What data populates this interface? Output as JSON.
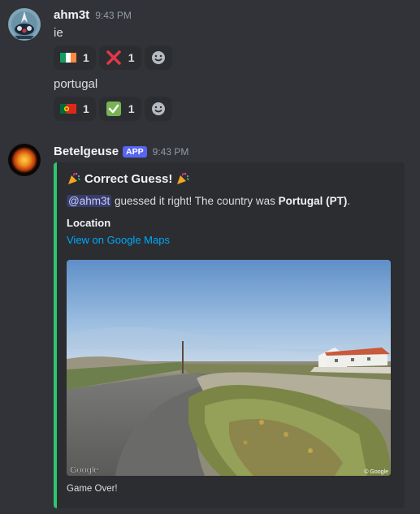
{
  "messages": [
    {
      "username": "ahm3t",
      "time": "9:43 PM",
      "lines": [
        {
          "text": "ie",
          "reactions": [
            {
              "emoji": "flag-ireland",
              "count": "1"
            },
            {
              "emoji": "cross-mark",
              "count": "1"
            }
          ]
        },
        {
          "text": "portugal",
          "reactions": [
            {
              "emoji": "flag-portugal",
              "count": "1"
            },
            {
              "emoji": "check-mark",
              "count": "1"
            }
          ]
        }
      ]
    },
    {
      "username": "Betelgeuse",
      "badge": "APP",
      "time": "9:43 PM",
      "embed": {
        "accent_color": "#2dc770",
        "title": "Correct Guess!",
        "title_icon": "party-popper-icon",
        "mention": "@ahm3t",
        "desc_middle": " guessed it right! The country was ",
        "country": "Portugal (PT)",
        "desc_end": ".",
        "field_name": "Location",
        "field_link": "View on Google Maps",
        "image_watermark": "Google",
        "image_copyright": "© Google",
        "footer": "Game Over!"
      }
    }
  ]
}
